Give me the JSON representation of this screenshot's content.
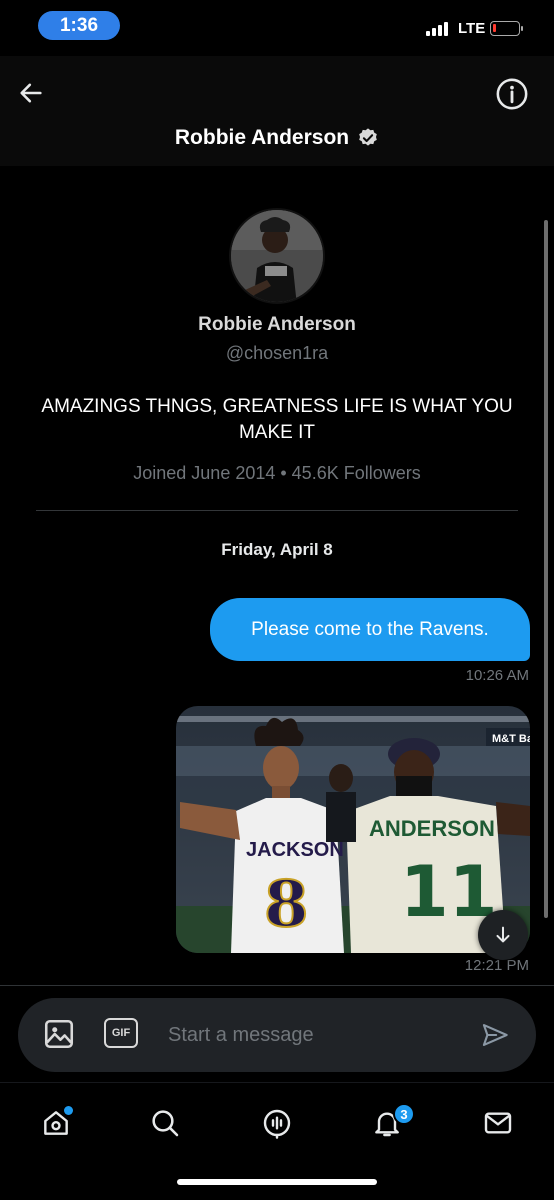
{
  "status_bar": {
    "time": "1:36",
    "network": "LTE",
    "battery_level": 0.12,
    "battery_color": "#ff3b30"
  },
  "header": {
    "back_icon": "arrow-left-icon",
    "title": "Robbie Anderson",
    "verified_icon": "verified-badge-icon",
    "info_icon": "info-icon"
  },
  "profile": {
    "name": "Robbie Anderson",
    "handle": "@chosen1ra",
    "bio": "AMAZINGS THNGS,  GREATNESS LIFE IS WHAT YOU MAKE IT",
    "meta": "Joined June 2014 • 45.6K Followers"
  },
  "conversation": {
    "date_separator": "Friday, April 8",
    "messages": [
      {
        "type": "text",
        "text": "Please come to the Ravens.",
        "time": "10:26 AM"
      },
      {
        "type": "image",
        "time": "12:21 PM",
        "jerseys": [
          {
            "name": "JACKSON",
            "number": "8"
          },
          {
            "name": "ANDERSON",
            "number": "11"
          }
        ],
        "stadium_sign": "M&T Ba"
      }
    ]
  },
  "composer": {
    "media_icon": "image-icon",
    "gif_label": "GIF",
    "placeholder": "Start a message",
    "send_icon": "send-icon"
  },
  "bottom_nav": {
    "items": [
      {
        "name": "home",
        "icon": "home-icon",
        "has_dot": true
      },
      {
        "name": "search",
        "icon": "search-icon"
      },
      {
        "name": "spaces",
        "icon": "spaces-icon"
      },
      {
        "name": "notifications",
        "icon": "bell-icon",
        "badge": "3"
      },
      {
        "name": "messages",
        "icon": "mail-icon"
      }
    ]
  },
  "colors": {
    "accent": "#1d9bf0",
    "background": "#000000",
    "muted_text": "#71767b",
    "time_pill": "#2f7fe8"
  }
}
